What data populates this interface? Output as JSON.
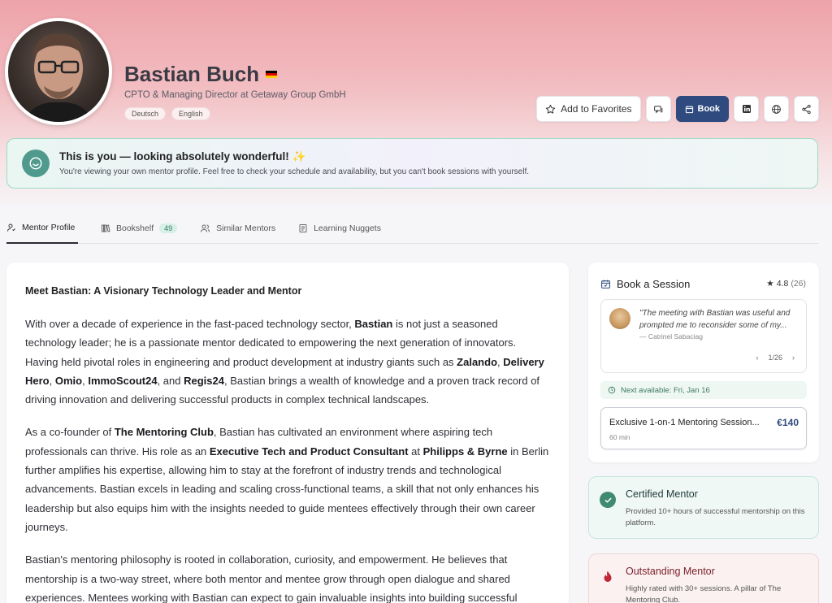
{
  "profile": {
    "name": "Bastian Buch",
    "flag_colors": [
      "#000000",
      "#dd0000",
      "#ffce00"
    ],
    "title": "CPTO & Managing Director at Getaway Group GmbH",
    "languages": [
      "Deutsch",
      "English"
    ]
  },
  "actions": {
    "favorites_label": "Add to Favorites",
    "book_label": "Book"
  },
  "banner": {
    "title": "This is you — looking absolutely wonderful! ✨",
    "text": "You're viewing your own mentor profile. Feel free to check your schedule and availability, but you can't book sessions with yourself."
  },
  "tabs": [
    {
      "label": "Mentor Profile",
      "icon": "user-icon"
    },
    {
      "label": "Bookshelf",
      "icon": "books-icon",
      "badge": "49"
    },
    {
      "label": "Similar Mentors",
      "icon": "users-icon"
    },
    {
      "label": "Learning Nuggets",
      "icon": "document-icon"
    }
  ],
  "bio": {
    "heading": "Meet Bastian: A Visionary Technology Leader and Mentor",
    "p1": {
      "a": "With over a decade of experience in the fast-paced technology sector, ",
      "b1": "Bastian",
      "c": " is not just a seasoned technology leader; he is a passionate mentor dedicated to empowering the next generation of innovators. Having held pivotal roles in engineering and product development at industry giants such as ",
      "b2": "Zalando",
      "d": ", ",
      "b3": "Delivery Hero",
      "e": ", ",
      "b4": "Omio",
      "f": ", ",
      "b5": "ImmoScout24",
      "g": ", and ",
      "b6": "Regis24",
      "h": ", Bastian brings a wealth of knowledge and a proven track record of driving innovation and delivering successful products in complex technical landscapes."
    },
    "p2": {
      "a": "As a co-founder of ",
      "b1": "The Mentoring Club",
      "c": ", Bastian has cultivated an environment where aspiring tech professionals can thrive. His role as an ",
      "b2": "Executive Tech and Product Consultant",
      "d": " at ",
      "b3": "Philipps & Byrne",
      "e": " in Berlin further amplifies his expertise, allowing him to stay at the forefront of industry trends and technological advancements. Bastian excels in leading and scaling cross-functional teams, a skill that not only enhances his leadership but also equips him with the insights needed to guide mentees effectively through their own career journeys."
    },
    "p3": "Bastian's mentoring philosophy is rooted in collaboration, curiosity, and empowerment. He believes that mentorship is a two-way street, where both mentor and mentee grow through open dialogue and shared experiences. Mentees working with Bastian can expect to gain invaluable insights into building successful"
  },
  "booking": {
    "title": "Book a Session",
    "rating": "4.8",
    "rating_count": "(26)",
    "review": {
      "text": "\"The meeting with Bastian was useful and prompted me to reconsider some of my...",
      "author": "— Catrinel Sabaciag",
      "pager": "1/26"
    },
    "next_available": "Next available: Fri, Jan 16",
    "session": {
      "title": "Exclusive 1-on-1 Mentoring Session...",
      "price": "€140",
      "duration": "60 min"
    }
  },
  "badges": {
    "certified": {
      "title": "Certified Mentor",
      "text": "Provided 10+ hours of successful mentorship on this platform."
    },
    "outstanding": {
      "title": "Outstanding Mentor",
      "text": "Highly rated with 30+ sessions. A pillar of The Mentoring Club."
    }
  }
}
